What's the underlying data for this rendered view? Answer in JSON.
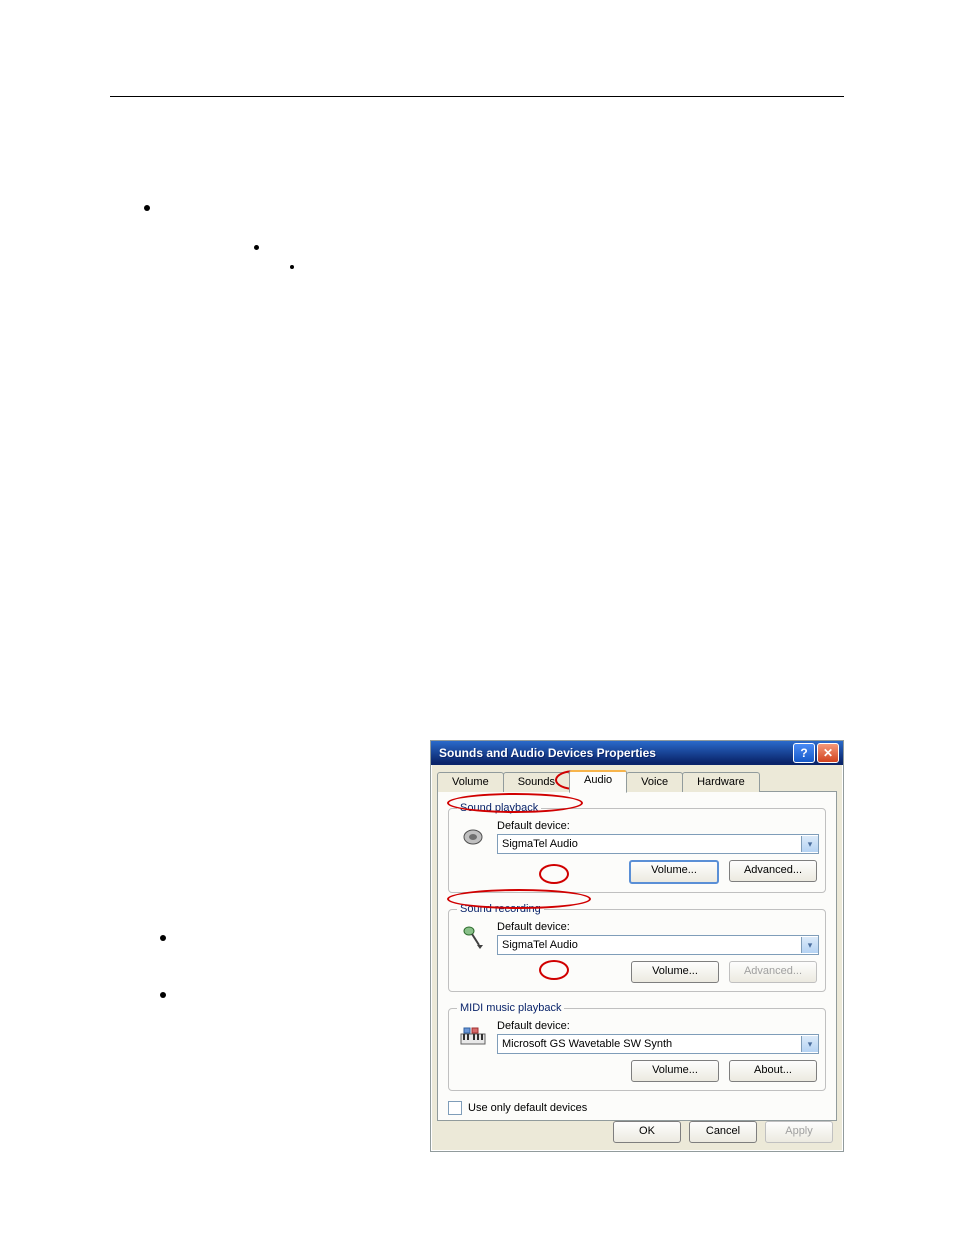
{
  "dialog": {
    "title": "Sounds and Audio Devices Properties",
    "tabs": [
      "Volume",
      "Sounds",
      "Audio",
      "Voice",
      "Hardware"
    ],
    "active_tab": "Audio",
    "groups": {
      "playback": {
        "legend": "Sound playback",
        "label": "Default device:",
        "device": "SigmaTel Audio",
        "buttons": {
          "volume": "Volume...",
          "advanced": "Advanced..."
        }
      },
      "recording": {
        "legend": "Sound recording",
        "label": "Default device:",
        "device": "SigmaTel Audio",
        "buttons": {
          "volume": "Volume...",
          "advanced": "Advanced..."
        }
      },
      "midi": {
        "legend": "MIDI music playback",
        "label": "Default device:",
        "device": "Microsoft GS Wavetable SW Synth",
        "buttons": {
          "volume": "Volume...",
          "about": "About..."
        }
      }
    },
    "checkbox": "Use only default devices",
    "footer": {
      "ok": "OK",
      "cancel": "Cancel",
      "apply": "Apply"
    }
  }
}
